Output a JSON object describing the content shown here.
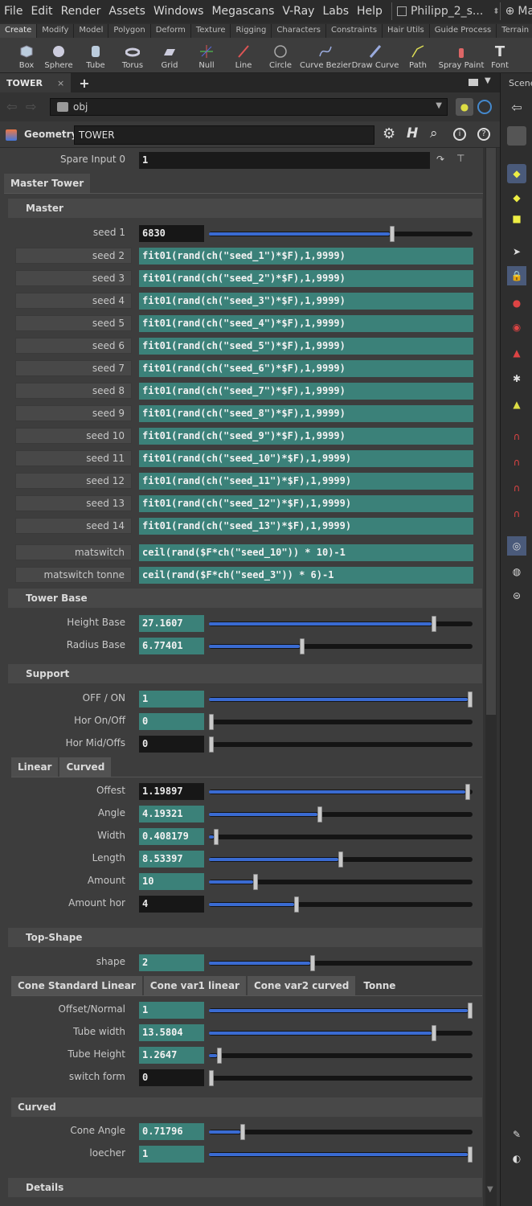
{
  "menubar": {
    "items": [
      "File",
      "Edit",
      "Render",
      "Assets",
      "Windows",
      "Megascans",
      "V-Ray",
      "Labs",
      "Help"
    ],
    "desktop": "Philipp_2_s...",
    "extra": "Ma"
  },
  "shelf": {
    "tabs": [
      "Create",
      "Modify",
      "Model",
      "Polygon",
      "Deform",
      "Texture",
      "Rigging",
      "Characters",
      "Constraints",
      "Hair Utils",
      "Guide Process",
      "Terrain"
    ],
    "tools": [
      "Box",
      "Sphere",
      "Tube",
      "Torus",
      "Grid",
      "Null",
      "Line",
      "Circle",
      "Curve Bezier",
      "Draw Curve",
      "Path",
      "Spray Paint",
      "Font"
    ]
  },
  "pane": {
    "tab": "TOWER",
    "close": "×",
    "add": "+",
    "path": "obj",
    "right_label": "Scene"
  },
  "header": {
    "type": "Geometry",
    "name": "TOWER"
  },
  "spare": {
    "label": "Spare Input 0",
    "value": "1"
  },
  "tab_master_tower": "Master Tower",
  "sections": {
    "master": "Master",
    "tower_base": "Tower Base",
    "support": "Support",
    "top_shape": "Top-Shape",
    "curved": "Curved",
    "details": "Details"
  },
  "master": {
    "seed1": {
      "label": "seed 1",
      "value": "6830",
      "pos": 0.7
    },
    "seeds": [
      {
        "label": "seed 2",
        "expr": "fit01(rand(ch(\"seed_1\")*$F),1,9999)"
      },
      {
        "label": "seed 3",
        "expr": "fit01(rand(ch(\"seed_2\")*$F),1,9999)"
      },
      {
        "label": "seed 4",
        "expr": "fit01(rand(ch(\"seed_3\")*$F),1,9999)"
      },
      {
        "label": "seed 5",
        "expr": "fit01(rand(ch(\"seed_4\")*$F),1,9999)"
      },
      {
        "label": "seed 6",
        "expr": "fit01(rand(ch(\"seed_5\")*$F),1,9999)"
      },
      {
        "label": "seed 7",
        "expr": "fit01(rand(ch(\"seed_6\")*$F),1,9999)"
      },
      {
        "label": "seed 8",
        "expr": "fit01(rand(ch(\"seed_7\")*$F),1,9999)"
      },
      {
        "label": "seed 9",
        "expr": "fit01(rand(ch(\"seed_8\")*$F),1,9999)"
      },
      {
        "label": "seed 10",
        "expr": "fit01(rand(ch(\"seed_9\")*$F),1,9999)"
      },
      {
        "label": "seed 11",
        "expr": "fit01(rand(ch(\"seed_10\")*$F),1,9999)"
      },
      {
        "label": "seed 12",
        "expr": "fit01(rand(ch(\"seed_11\")*$F),1,9999)"
      },
      {
        "label": "seed 13",
        "expr": "fit01(rand(ch(\"seed_12\")*$F),1,9999)"
      },
      {
        "label": "seed 14",
        "expr": "fit01(rand(ch(\"seed_13\")*$F),1,9999)"
      }
    ],
    "matswitch": {
      "label": "matswitch",
      "expr": "ceil(rand($F*ch(\"seed_10\")) * 10)-1"
    },
    "matswitch_tonne": {
      "label": "matswitch tonne",
      "expr": "ceil(rand($F*ch(\"seed_3\")) * 6)-1"
    }
  },
  "tower_base": [
    {
      "label": "Height Base",
      "value": "27.1607",
      "teal": true,
      "pos": 0.86
    },
    {
      "label": "Radius Base",
      "value": "6.77401",
      "teal": true,
      "pos": 0.35
    }
  ],
  "support": [
    {
      "label": "OFF / ON",
      "value": "1",
      "teal": true,
      "pos": 1.0
    },
    {
      "label": "Hor On/Off",
      "value": "0",
      "teal": true,
      "pos": 0.0
    },
    {
      "label": "Hor Mid/Offs",
      "value": "0",
      "teal": false,
      "pos": 0.0
    }
  ],
  "support_tabs": [
    "Linear",
    "Curved"
  ],
  "linear": [
    {
      "label": "Offest",
      "value": "1.19897",
      "teal": false,
      "pos": 0.99
    },
    {
      "label": "Angle",
      "value": "4.19321",
      "teal": true,
      "pos": 0.42
    },
    {
      "label": "Width",
      "value": "0.408179",
      "teal": true,
      "pos": 0.02
    },
    {
      "label": "Length",
      "value": "8.53397",
      "teal": true,
      "pos": 0.5
    },
    {
      "label": "Amount",
      "value": "10",
      "teal": true,
      "pos": 0.17
    },
    {
      "label": "Amount hor",
      "value": "4",
      "teal": false,
      "pos": 0.33
    }
  ],
  "top_shape": {
    "label": "shape",
    "value": "2",
    "pos": 0.39
  },
  "top_tabs": [
    "Cone Standard Linear",
    "Cone var1 linear",
    "Cone var2 curved",
    "Tonne"
  ],
  "tonne": [
    {
      "label": "Offset/Normal",
      "value": "1",
      "teal": true,
      "pos": 1.0
    },
    {
      "label": "Tube width",
      "value": "13.5804",
      "teal": true,
      "pos": 0.86
    },
    {
      "label": "Tube Height",
      "value": "1.2647",
      "teal": true,
      "pos": 0.03
    },
    {
      "label": "switch form",
      "value": "0",
      "teal": false,
      "pos": 0.0
    }
  ],
  "curved": [
    {
      "label": "Cone Angle",
      "value": "0.71796",
      "teal": true,
      "pos": 0.12
    },
    {
      "label": "loecher",
      "value": "1",
      "teal": true,
      "pos": 1.0
    }
  ],
  "colors": {
    "teal_field": "#3b8179",
    "slider_fill": "#3a6bd2"
  }
}
